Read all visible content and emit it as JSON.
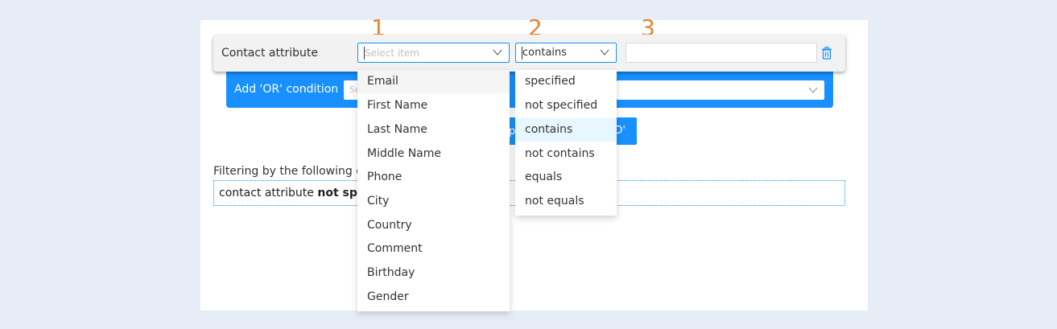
{
  "steps": [
    "1",
    "2",
    "3"
  ],
  "condition": {
    "label": "Contact attribute",
    "attribute_placeholder": "Select item",
    "operator_value": "contains",
    "value_input": ""
  },
  "or_bar": {
    "label": "Add 'OR' condition",
    "select_placeholder": "Se"
  },
  "and_button": {
    "left_text": "p",
    "right_text": "D'"
  },
  "filter": {
    "title": "Filtering by the following co",
    "text_prefix": "contact attribute ",
    "text_bold": "not spec"
  },
  "attribute_options": [
    "Email",
    "First Name",
    "Last Name",
    "Middle Name",
    "Phone",
    "City",
    "Country",
    "Comment",
    "Birthday",
    "Gender"
  ],
  "operator_options": [
    "specified",
    "not specified",
    "contains",
    "not contains",
    "equals",
    "not equals"
  ],
  "colors": {
    "accent": "#1890ff",
    "step_number": "#e8842c",
    "selected_bg": "#e6f7ff",
    "hover_bg": "#f5f5f5"
  },
  "icons": {
    "trash": "trash-icon",
    "chevron": "chevron-down-icon"
  }
}
